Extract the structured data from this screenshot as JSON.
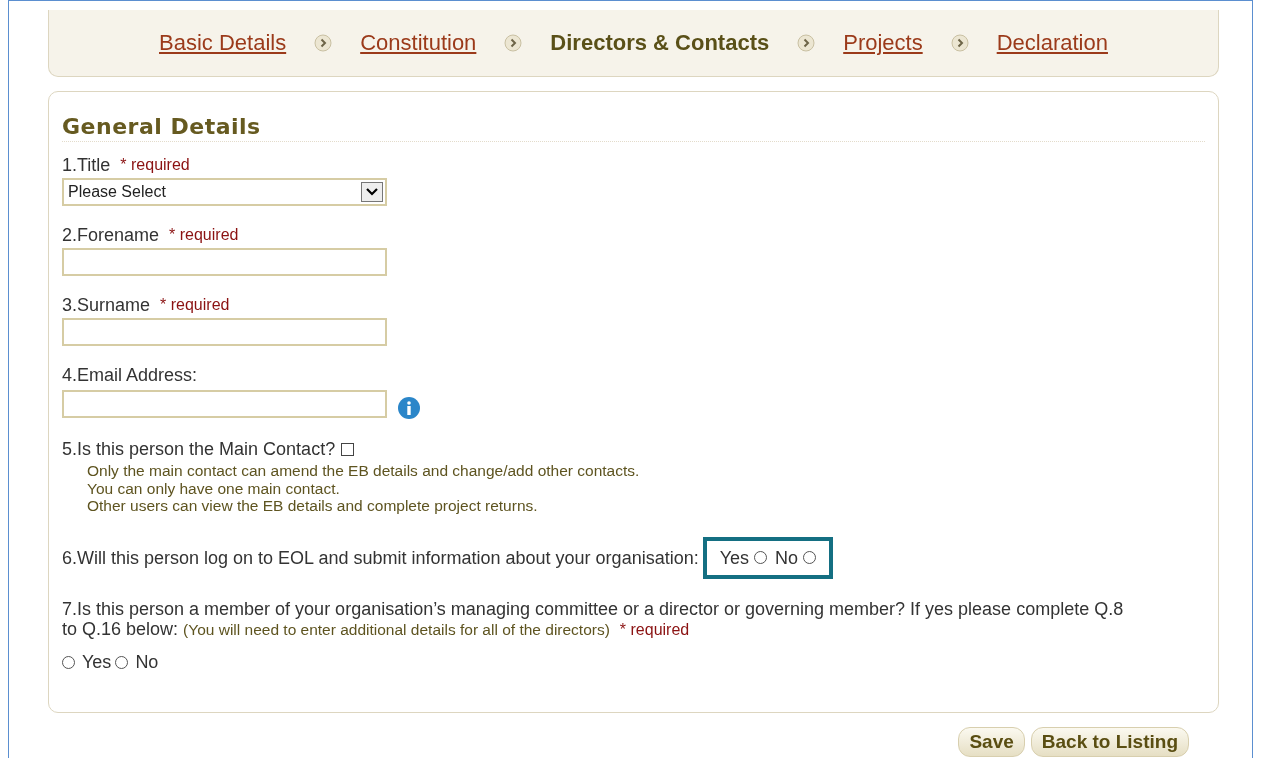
{
  "steps": [
    {
      "label": "Basic Details",
      "current": false
    },
    {
      "label": "Constitution",
      "current": false
    },
    {
      "label": "Directors & Contacts",
      "current": true
    },
    {
      "label": "Projects",
      "current": false
    },
    {
      "label": "Declaration",
      "current": false
    }
  ],
  "section_title": "General Details",
  "questions": [
    {
      "kind": "select",
      "label": "1.Title",
      "required": "* required",
      "value": "Please Select"
    },
    {
      "kind": "text",
      "label": "2.Forename",
      "required": "* required"
    },
    {
      "kind": "text",
      "label": "3.Surname",
      "required": "* required"
    },
    {
      "kind": "text",
      "label": "4.Email Address:",
      "info": true
    },
    {
      "kind": "checkbox",
      "label": "5.Is this person the Main Contact?",
      "checked": false,
      "notes": [
        "Only the main contact can amend the EB details and change/add other contacts.",
        "You can only have one main contact.",
        "Other users can view the EB details and complete project returns."
      ]
    },
    {
      "kind": "radio-inline",
      "label": "6.Will this person log on to EOL and submit information about your organisation:",
      "highlighted": true,
      "options": [
        {
          "label": "Yes",
          "selected": false
        },
        {
          "label": "No",
          "selected": false
        }
      ]
    },
    {
      "kind": "radio-block",
      "label": "7.Is this person a member of your organisation’s managing committee or a director or governing member? If yes please complete Q.8 to Q.16 below:",
      "note": "(You will need to enter additional details for all of the directors)",
      "required": "* required",
      "options": [
        {
          "label": "Yes",
          "selected": false
        },
        {
          "label": "No",
          "selected": false
        }
      ]
    }
  ],
  "buttons": [
    "Save",
    "Back to Listing"
  ]
}
